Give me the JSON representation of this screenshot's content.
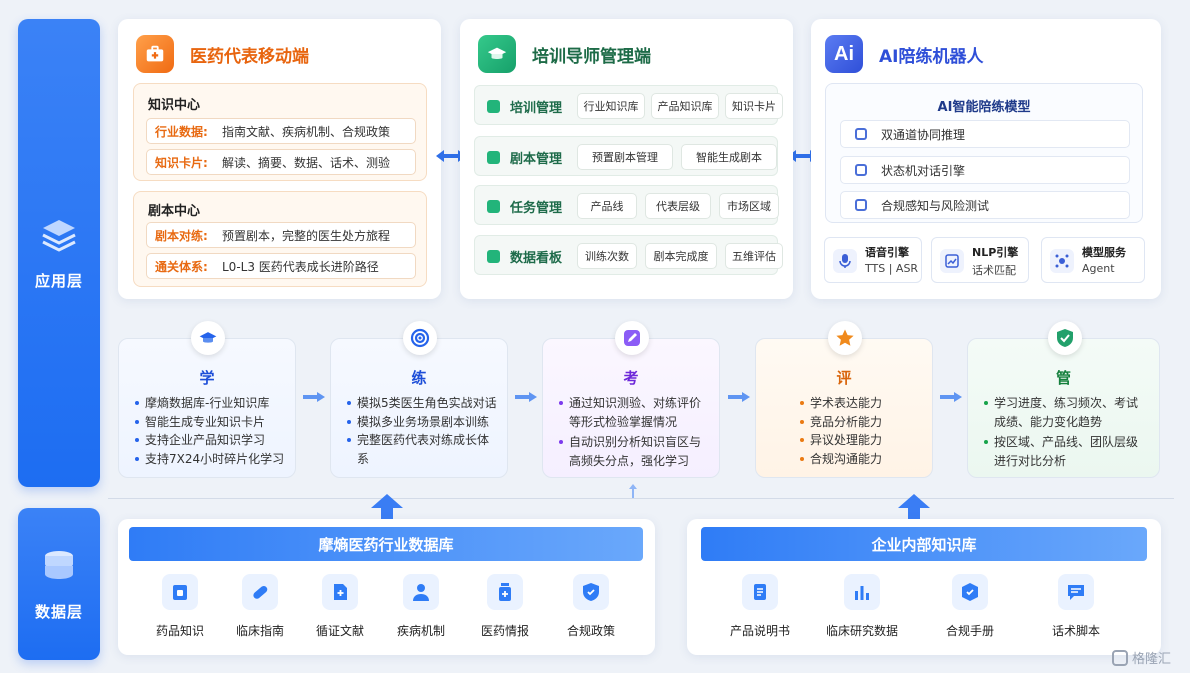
{
  "layers": {
    "app": "应用层",
    "data": "数据层"
  },
  "rep": {
    "title": "医药代表移动端",
    "knowledge": {
      "title": "知识中心",
      "rows": [
        {
          "k": "行业数据:",
          "v": "指南文献、疾病机制、合规政策"
        },
        {
          "k": "知识卡片:",
          "v": "解读、摘要、数据、话术、测验"
        }
      ]
    },
    "script": {
      "title": "剧本中心",
      "rows": [
        {
          "k": "剧本对练:",
          "v": "预置剧本，完整的医生处方旅程"
        },
        {
          "k": "通关体系:",
          "v": "L0-L3 医药代表成长进阶路径"
        }
      ]
    }
  },
  "trainer": {
    "title": "培训导师管理端",
    "rows": [
      {
        "label": "培训管理",
        "chips": [
          "行业知识库",
          "产品知识库",
          "知识卡片"
        ]
      },
      {
        "label": "剧本管理",
        "chips": [
          "预置剧本管理",
          "智能生成剧本"
        ]
      },
      {
        "label": "任务管理",
        "chips": [
          "产品线",
          "代表层级",
          "市场区域"
        ]
      },
      {
        "label": "数据看板",
        "chips": [
          "训练次数",
          "剧本完成度",
          "五维评估"
        ]
      }
    ]
  },
  "ai": {
    "icon_text": "Ai",
    "title": "AI陪练机器人",
    "model_title": "AI智能陪练模型",
    "model_rows": [
      "双通道协同推理",
      "状态机对话引擎",
      "合规感知与风险测试"
    ],
    "services": [
      {
        "name": "语音引擎",
        "sub": "TTS | ASR"
      },
      {
        "name": "NLP引擎",
        "sub": "话术匹配"
      },
      {
        "name": "模型服务",
        "sub": "Agent"
      }
    ]
  },
  "stages": [
    {
      "title": "学",
      "color": "#2563eb",
      "items": [
        "摩熵数据库-行业知识库",
        "智能生成专业知识卡片",
        "支持企业产品知识学习",
        "支持7X24小时碎片化学习"
      ]
    },
    {
      "title": "练",
      "color": "#2563eb",
      "items": [
        "模拟5类医生角色实战对话",
        "模拟多业务场景剧本训练",
        "完整医药代表对练成长体系"
      ]
    },
    {
      "title": "考",
      "color": "#7c3aed",
      "items": [
        "通过知识测验、对练评价等形式检验掌握情况",
        "自动识别分析知识盲区与高频失分点，强化学习"
      ]
    },
    {
      "title": "评",
      "color": "#ea7a12",
      "items": [
        "学术表达能力",
        "竞品分析能力",
        "异议处理能力",
        "合规沟通能力"
      ]
    },
    {
      "title": "管",
      "color": "#16a34a",
      "items": [
        "学习进度、练习频次、考试成绩、能力变化趋势",
        "按区域、产品线、团队层级进行对比分析"
      ]
    }
  ],
  "db1": {
    "title": "摩熵医药行业数据库",
    "items": [
      "药品知识",
      "临床指南",
      "循证文献",
      "疾病机制",
      "医药情报",
      "合规政策"
    ]
  },
  "db2": {
    "title": "企业内部知识库",
    "items": [
      "产品说明书",
      "临床研究数据",
      "合规手册",
      "话术脚本"
    ]
  },
  "watermark": "格隆汇",
  "colors": {
    "blue": "#2f7cf6",
    "orange": "#f07a1a",
    "green": "#22b47a",
    "purple": "#4b6fd8"
  }
}
